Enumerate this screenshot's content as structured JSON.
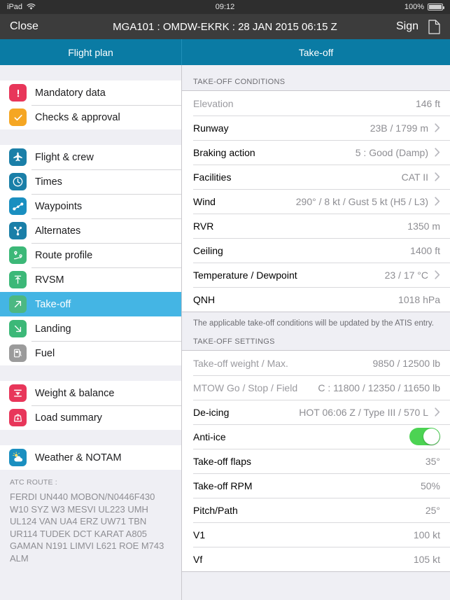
{
  "status_bar": {
    "device": "iPad",
    "wifi_icon": "wifi-icon",
    "time": "09:12",
    "battery_percent": "100%",
    "battery_icon": "battery-icon"
  },
  "nav_bar": {
    "close_label": "Close",
    "title": "MGA101 : OMDW-EKRK : 28 JAN 2015 06:15 Z",
    "sign_label": "Sign",
    "document_icon": "document-icon"
  },
  "tabs": [
    {
      "label": "Flight plan",
      "selected": false
    },
    {
      "label": "Take-off",
      "selected": true
    }
  ],
  "colors": {
    "tab_bar": "#0a7ba4",
    "selected_row": "#44b5e4",
    "nav_bar": "#3c3c3c",
    "status_bar": "#2e2e2e",
    "toggle_on": "#4cd353",
    "icon_red": "#e8365a",
    "icon_orange": "#f5a623",
    "icon_blue": "#1a7fa8",
    "icon_green": "#3cb878",
    "icon_grey": "#9b9b9b"
  },
  "sidebar": {
    "groups": [
      {
        "items": [
          {
            "label": "Mandatory data",
            "icon": "exclamation-icon",
            "color": "#e8365a",
            "selected": false
          },
          {
            "label": "Checks & approval",
            "icon": "check-icon",
            "color": "#f5a623",
            "selected": false
          }
        ]
      },
      {
        "items": [
          {
            "label": "Flight & crew",
            "icon": "airplane-icon",
            "color": "#1a7fa8",
            "selected": false
          },
          {
            "label": "Times",
            "icon": "clock-icon",
            "color": "#1a7fa8",
            "selected": false
          },
          {
            "label": "Waypoints",
            "icon": "waypoints-icon",
            "color": "#1a8fc0",
            "selected": false
          },
          {
            "label": "Alternates",
            "icon": "alternates-icon",
            "color": "#1a7fa8",
            "selected": false
          },
          {
            "label": "Route profile",
            "icon": "route-pin-icon",
            "color": "#3cb878",
            "selected": false
          },
          {
            "label": "RVSM",
            "icon": "rvsm-arrow-icon",
            "color": "#3cb878",
            "selected": false
          },
          {
            "label": "Take-off",
            "icon": "takeoff-arrow-icon",
            "color": "#3cb878",
            "selected": true
          },
          {
            "label": "Landing",
            "icon": "landing-arrow-icon",
            "color": "#3cb878",
            "selected": false
          },
          {
            "label": "Fuel",
            "icon": "fuel-pump-icon",
            "color": "#9b9b9b",
            "selected": false
          }
        ]
      },
      {
        "items": [
          {
            "label": "Weight & balance",
            "icon": "balance-icon",
            "color": "#e8365a",
            "selected": false
          },
          {
            "label": "Load summary",
            "icon": "load-bag-icon",
            "color": "#e8365a",
            "selected": false
          }
        ]
      },
      {
        "items": [
          {
            "label": "Weather & NOTAM",
            "icon": "weather-cloud-icon",
            "color": "#1a8fc0",
            "selected": false
          }
        ]
      }
    ],
    "atc_route": {
      "title": "ATC ROUTE :",
      "text": "FERDI UN440 MOBON/N0446F430 W10 SYZ W3 MESVI UL223 UMH UL124 VAN UA4 ERZ UW71 TBN UR114 TUDEK DCT KARAT A805 GAMAN N191 LIMVI L621 ROE M743 ALM"
    }
  },
  "main": {
    "conditions_header": "TAKE-OFF CONDITIONS",
    "conditions": [
      {
        "label": "Elevation",
        "value": "146 ft",
        "dim": true,
        "chevron": false
      },
      {
        "label": "Runway",
        "value": "23B / 1799 m",
        "dim": false,
        "chevron": true
      },
      {
        "label": "Braking action",
        "value": "5 : Good (Damp)",
        "dim": false,
        "chevron": true
      },
      {
        "label": "Facilities",
        "value": "CAT II",
        "dim": false,
        "chevron": true
      },
      {
        "label": "Wind",
        "value": "290° / 8 kt / Gust 5 kt (H5 / L3)",
        "dim": false,
        "chevron": true
      },
      {
        "label": "RVR",
        "value": "1350 m",
        "dim": false,
        "chevron": false
      },
      {
        "label": "Ceiling",
        "value": "1400 ft",
        "dim": false,
        "chevron": false
      },
      {
        "label": "Temperature / Dewpoint",
        "value": "23 / 17 °C",
        "dim": false,
        "chevron": true
      },
      {
        "label": "QNH",
        "value": "1018 hPa",
        "dim": false,
        "chevron": false
      }
    ],
    "note": "The applicable take-off conditions will be updated by the ATIS entry.",
    "settings_header": "TAKE-OFF SETTINGS",
    "settings": [
      {
        "label": "Take-off weight / Max.",
        "value": "9850 / 12500 lb",
        "dim": true,
        "chevron": false,
        "toggle": false
      },
      {
        "label": "MTOW Go / Stop / Field",
        "value": "C : 11800 / 12350 / 11650 lb",
        "dim": true,
        "chevron": false,
        "toggle": false
      },
      {
        "label": "De-icing",
        "value": "HOT 06:06 Z / Type III / 570 L",
        "dim": false,
        "chevron": true,
        "toggle": false
      },
      {
        "label": "Anti-ice",
        "value": "",
        "dim": false,
        "chevron": false,
        "toggle": true,
        "toggle_on": true
      },
      {
        "label": "Take-off flaps",
        "value": "35°",
        "dim": false,
        "chevron": false,
        "toggle": false
      },
      {
        "label": "Take-off RPM",
        "value": "50%",
        "dim": false,
        "chevron": false,
        "toggle": false
      },
      {
        "label": "Pitch/Path",
        "value": "25°",
        "dim": false,
        "chevron": false,
        "toggle": false
      },
      {
        "label": "V1",
        "value": "100 kt",
        "dim": false,
        "chevron": false,
        "toggle": false
      },
      {
        "label": "Vf",
        "value": "105 kt",
        "dim": false,
        "chevron": false,
        "toggle": false
      }
    ]
  }
}
